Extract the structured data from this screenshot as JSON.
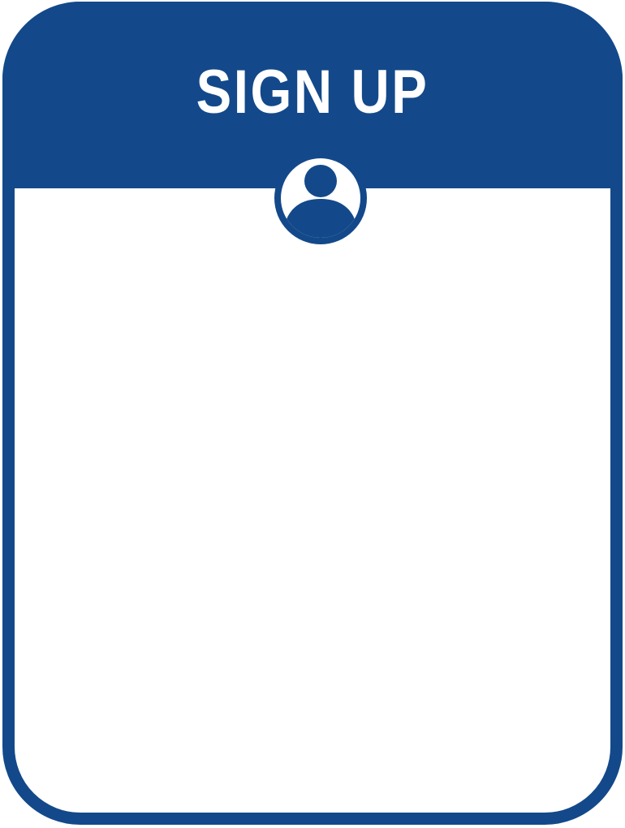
{
  "header": {
    "title": "SIGN UP"
  },
  "avatar": {
    "icon": "user-avatar-icon"
  },
  "colors": {
    "primary": "#13498a",
    "background": "#ffffff"
  }
}
